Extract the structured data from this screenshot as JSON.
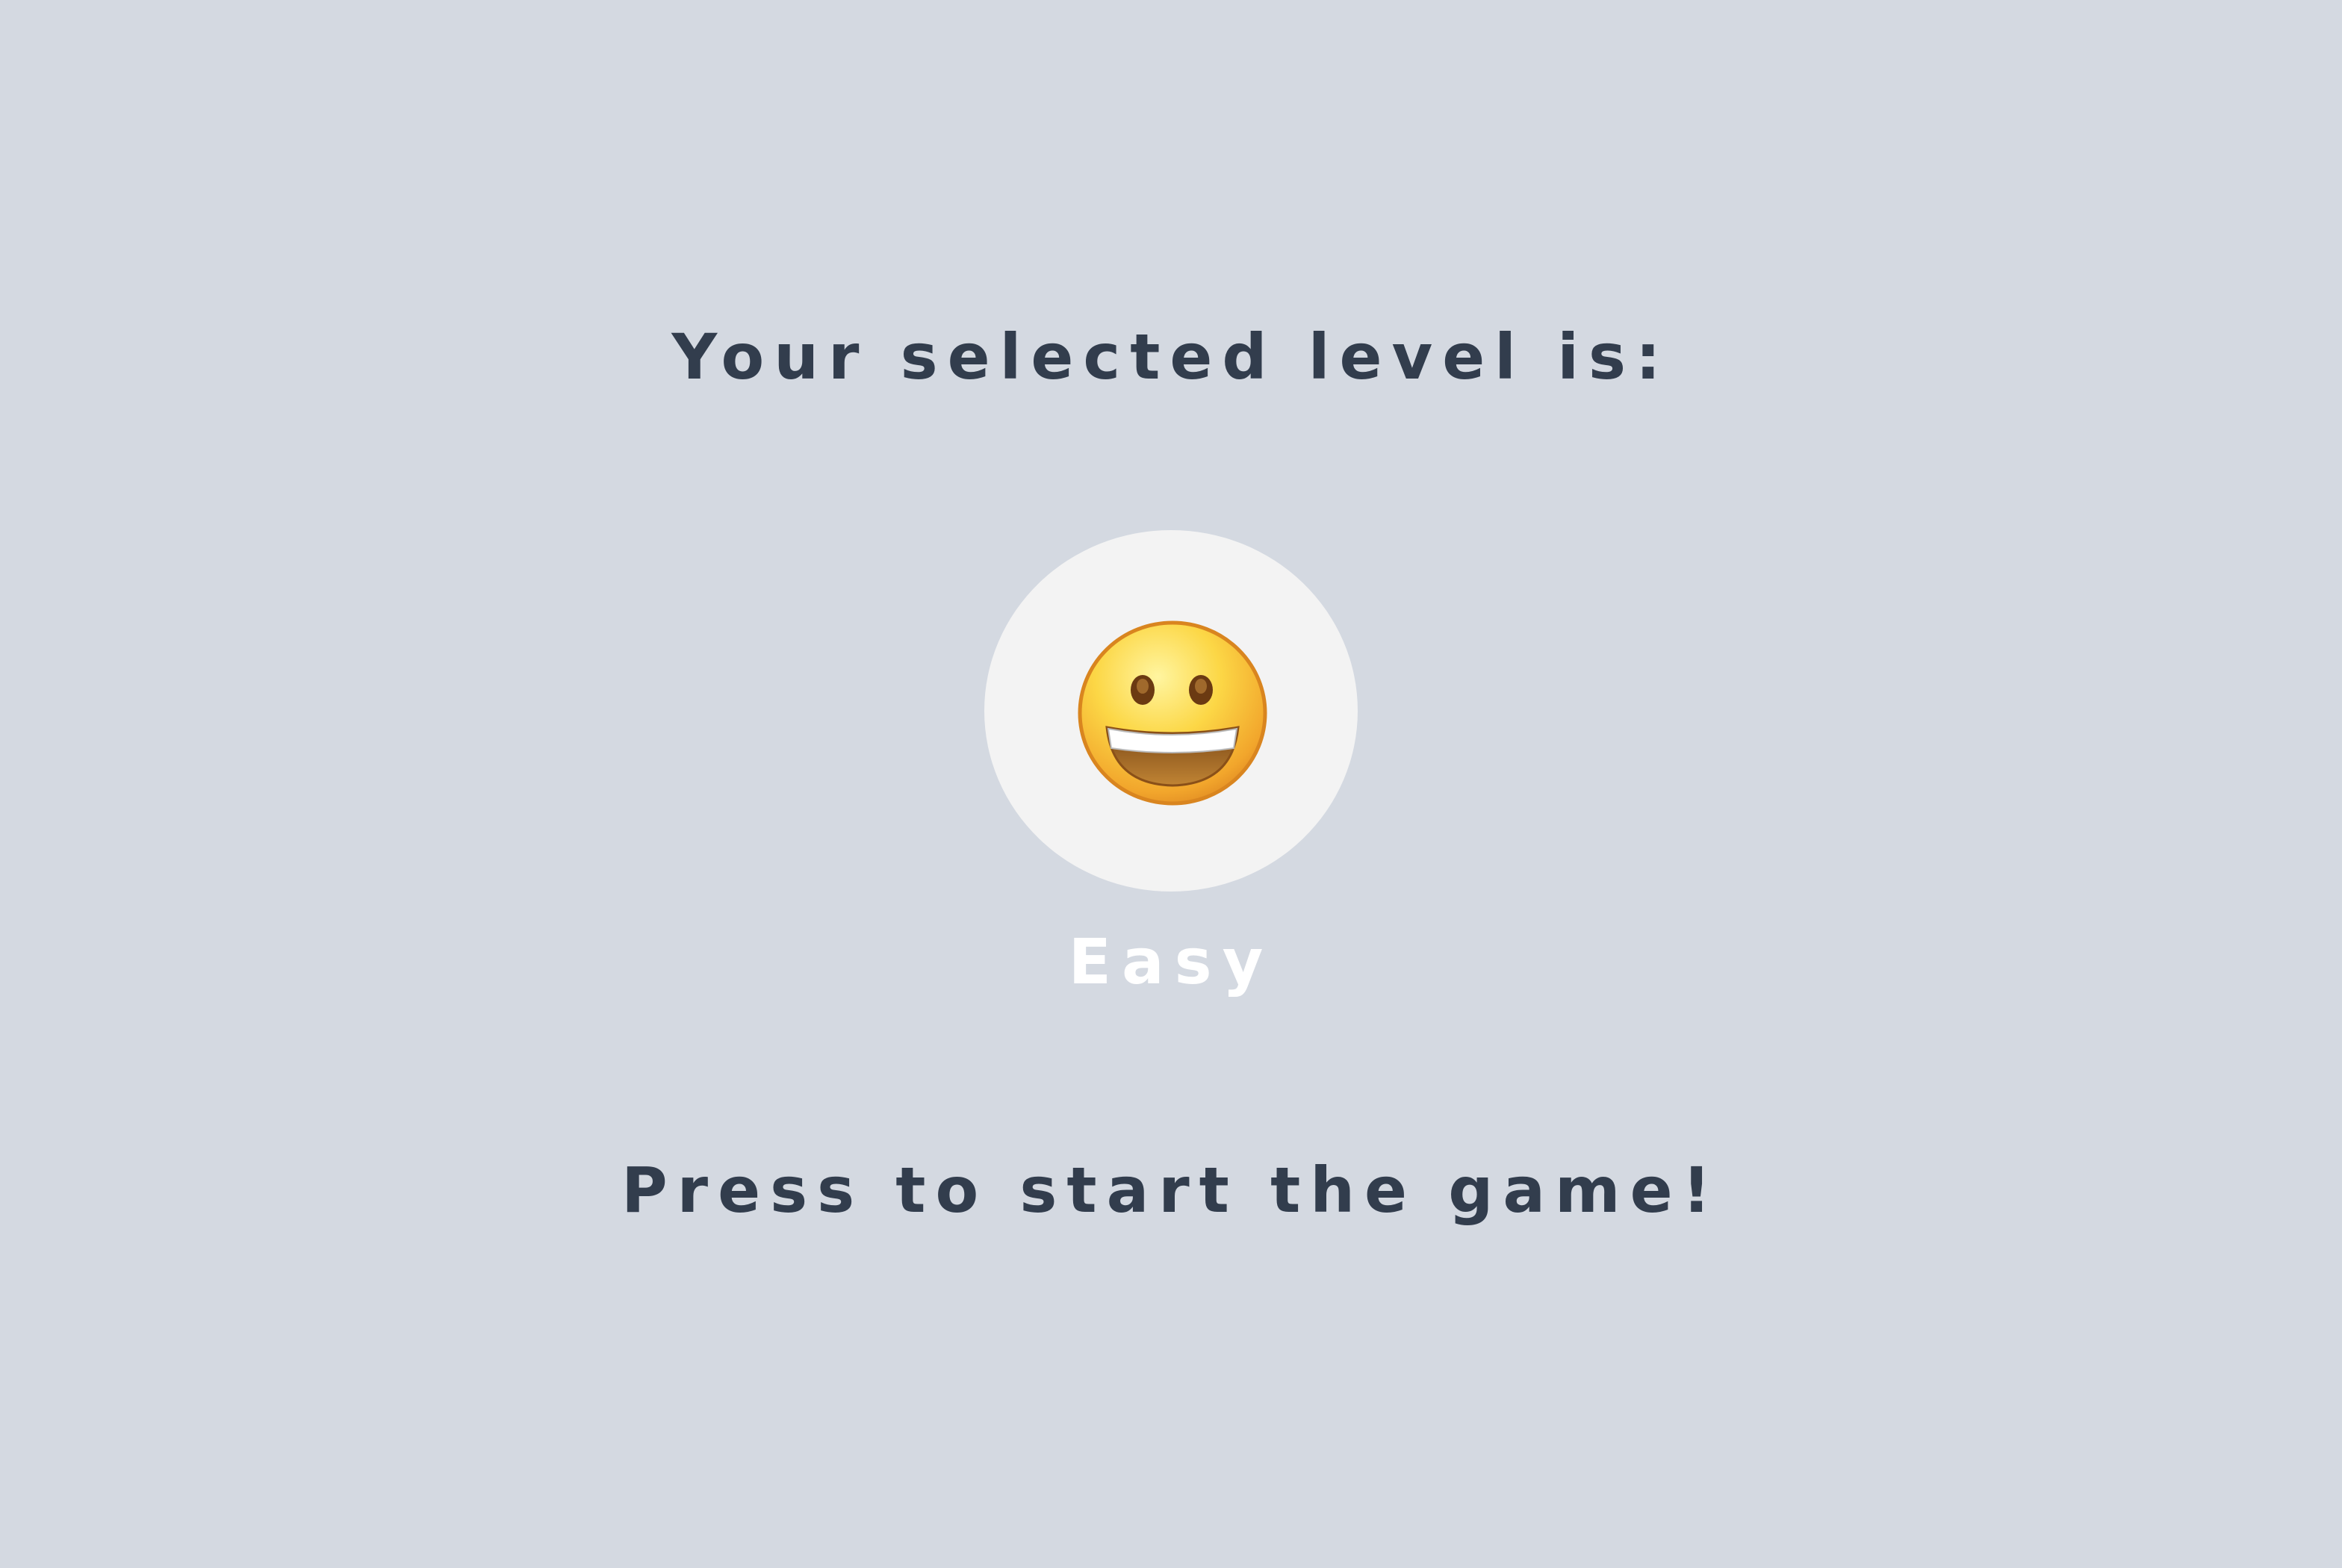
{
  "screen": {
    "title": "Your selected level is:",
    "prompt": "Press to start the game!"
  },
  "level": {
    "name": "Easy",
    "icon": "grinning-face-icon"
  },
  "colors": {
    "background": "#d4d9e1",
    "text": "#323d4d",
    "circle": "#f3f3f3",
    "level_label": "#ffffff"
  }
}
